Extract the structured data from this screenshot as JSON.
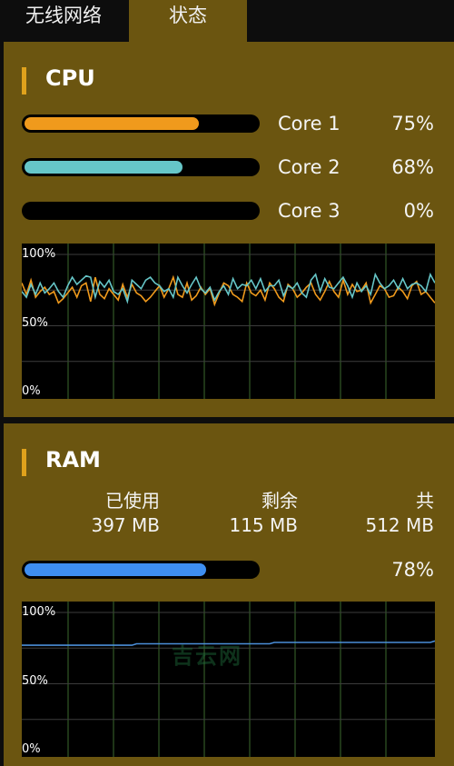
{
  "tabs": [
    {
      "label": "无线网络",
      "active": false
    },
    {
      "label": "状态",
      "active": true
    }
  ],
  "cpu": {
    "title": "CPU",
    "cores": [
      {
        "label": "Core 1",
        "percent": "75%",
        "value": 75,
        "color": "#f09a1c"
      },
      {
        "label": "Core 2",
        "percent": "68%",
        "value": 68,
        "color": "#66c6c8"
      },
      {
        "label": "Core 3",
        "percent": "0%",
        "value": 0,
        "color": "#f09a1c"
      }
    ],
    "graph": {
      "labels": {
        "top": "100%",
        "mid": "50%",
        "bottom": "0%"
      },
      "series": [
        {
          "color": "#f09a1c",
          "values": [
            80,
            72,
            82,
            70,
            74,
            77,
            72,
            74,
            66,
            69,
            73,
            77,
            70,
            78,
            80,
            67,
            84,
            72,
            69,
            76,
            72,
            68,
            79,
            70,
            79,
            73,
            71,
            67,
            70,
            74,
            78,
            70,
            76,
            84,
            72,
            70,
            80,
            68,
            71,
            77,
            72,
            76,
            65,
            73,
            80,
            78,
            72,
            70,
            67,
            80,
            73,
            71,
            75,
            68,
            80,
            76,
            70,
            67,
            79,
            76,
            70,
            73,
            77,
            80,
            72,
            68,
            74,
            81,
            74,
            70,
            82,
            72,
            79,
            74,
            75,
            80,
            66,
            72,
            78,
            76,
            70,
            71,
            77,
            74,
            69,
            78,
            81,
            72,
            74,
            70,
            66
          ]
        },
        {
          "color": "#66c6c8",
          "values": [
            74,
            70,
            79,
            72,
            80,
            73,
            76,
            80,
            74,
            70,
            78,
            84,
            79,
            82,
            85,
            84,
            70,
            81,
            77,
            82,
            74,
            72,
            76,
            67,
            82,
            79,
            76,
            82,
            84,
            80,
            78,
            74,
            76,
            70,
            84,
            78,
            73,
            79,
            84,
            76,
            73,
            77,
            68,
            74,
            78,
            72,
            83,
            76,
            79,
            78,
            82,
            76,
            83,
            74,
            78,
            78,
            82,
            71,
            78,
            76,
            80,
            73,
            70,
            82,
            86,
            74,
            83,
            77,
            76,
            80,
            84,
            78,
            70,
            80,
            74,
            78,
            72,
            86,
            80,
            76,
            78,
            82,
            76,
            83,
            76,
            79,
            80,
            78,
            74,
            86,
            80
          ]
        }
      ]
    }
  },
  "ram": {
    "title": "RAM",
    "used": {
      "label": "已使用",
      "value": "397 MB"
    },
    "free": {
      "label": "剩余",
      "value": "115 MB"
    },
    "total": {
      "label": "共",
      "value": "512 MB"
    },
    "percent": "78%",
    "usage": 78,
    "bar_color": "#3e8ef0",
    "graph": {
      "labels": {
        "top": "100%",
        "mid": "50%",
        "bottom": "0%"
      },
      "series": [
        {
          "color": "#4b8ed8",
          "values": [
            77,
            77,
            77,
            77,
            77,
            77,
            77,
            77,
            77,
            77,
            77,
            77,
            77,
            77,
            77,
            77,
            77,
            77,
            77,
            77,
            77,
            77,
            77,
            77,
            77,
            78,
            78,
            78,
            78,
            78,
            78,
            78,
            78,
            78,
            78,
            78,
            78,
            78,
            78,
            78,
            78,
            78,
            78,
            78,
            78,
            78,
            78,
            78,
            78,
            78,
            78,
            78,
            78,
            78,
            78,
            79,
            79,
            79,
            79,
            79,
            79,
            79,
            79,
            79,
            79,
            79,
            79,
            79,
            79,
            79,
            79,
            79,
            79,
            79,
            79,
            79,
            79,
            79,
            79,
            79,
            79,
            79,
            79,
            79,
            79,
            79,
            79,
            79,
            79,
            79,
            80
          ]
        }
      ]
    },
    "watermark": "吉云网"
  }
}
